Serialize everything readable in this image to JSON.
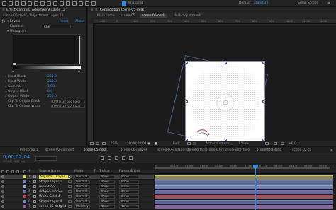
{
  "toolbar": {
    "snapping_label": "Snapping",
    "workspace_default": "Default",
    "workspace_standard": "Standard",
    "workspace_small": "Small Screen"
  },
  "effect_controls": {
    "tab_title": "Effect Controls: Adjustment Layer 12",
    "breadcrumb": "scene-05-desk • Adjustment Layer 12",
    "fx_name": "Levels",
    "reset_label": "Reset",
    "about_label": "About",
    "channel_label": "Channel:",
    "channel_value": "RGB",
    "histogram_label": "Histogram",
    "params": [
      {
        "label": "Input Black",
        "value": "255.0"
      },
      {
        "label": "Input White",
        "value": "255.0"
      },
      {
        "label": "Gamma",
        "value": "1.00"
      },
      {
        "label": "Output Black",
        "value": "0.0"
      },
      {
        "label": "Output White",
        "value": "255.0"
      }
    ],
    "clip_black_label": "Clip To Output Black",
    "clip_black_value": "Off for 32 bpc Color",
    "clip_white_label": "Clip To Output White",
    "clip_white_value": "Off for 32 bpc Color"
  },
  "composition": {
    "tab_title": "Composition scene-05-desk",
    "breadcrumbs": [
      "Main comp",
      "scene-05",
      "scene-05-desk",
      "desk-adjustment"
    ],
    "ruler_ticks": [
      "-100",
      "0",
      "100",
      "200",
      "300",
      "400",
      "500",
      "600",
      "700",
      "800",
      "900",
      "1000",
      "1100",
      "1200"
    ],
    "footer": {
      "zoom": "25%",
      "timecode": "0;00;02;04",
      "resolution": "Full",
      "camera": "Active Camera",
      "views": "1 View",
      "exposure": "+0.0"
    }
  },
  "timeline_tabs": [
    "Pre-comp 1",
    "scene-02-connect",
    "scene-05-desk",
    "scene-06-deliver",
    "scene-07-collaborate-interface",
    "scene-07-multiply-interface",
    "scene08-delete",
    "scene-02-cs"
  ],
  "timeline": {
    "timecode": "0;00;02;04",
    "frames_label": "00064 (29.97 fps)",
    "header": {
      "num": "#",
      "source_name": "Source Name",
      "mode": "Mode",
      "t": "T",
      "trkmat": "TrkMat",
      "parent": "Parent & Link"
    },
    "time_ticks": [
      "0f",
      "00:15f",
      "01:00f",
      "01:15f",
      "02:00f",
      "02:15f",
      "03:00f",
      "03:15f",
      "04:00f",
      "04:15f",
      "05:00f",
      "05:15f"
    ],
    "layers": [
      {
        "num": "1",
        "name": "Adjustm...Layer 12",
        "mode": "Normal",
        "trkmat": "None",
        "parent": "None",
        "color": "#d6c64a",
        "bar": "#8a8560",
        "selected": true
      },
      {
        "num": "2",
        "name": "Shape Layer 1",
        "mode": "Normal",
        "trkmat": "None",
        "parent": "None",
        "color": "#6a78c8",
        "bar": "#5c6898",
        "selected": false
      },
      {
        "num": "3",
        "name": "repeat-dot",
        "mode": "Normal",
        "trkmat": "None",
        "parent": "None",
        "color": "#8aa3d0",
        "bar": "#6f7fa5",
        "selected": false
      },
      {
        "num": "4",
        "name": "dotgrid-motion",
        "mode": "Normal",
        "trkmat": "None",
        "parent": "None",
        "color": "#7a6ab8",
        "bar": "#6b6aa0",
        "selected": false
      },
      {
        "num": "5",
        "name": "White Solid 4",
        "mode": "Normal",
        "trkmat": "None",
        "parent": "None",
        "color": "#c2453e",
        "bar": "#8f5f66",
        "selected": false
      },
      {
        "num": "6",
        "name": "Shape Layer 4",
        "mode": "Normal",
        "trkmat": "None",
        "parent": "None",
        "color": "#6a78c8",
        "bar": "#5c6898",
        "selected": false
      },
      {
        "num": "7",
        "name": "scene-05-dotgrid",
        "mode": "Multiply",
        "trkmat": "None",
        "parent": "None",
        "color": "#a05a9a",
        "bar": "#7a6a98",
        "selected": false
      }
    ]
  }
}
